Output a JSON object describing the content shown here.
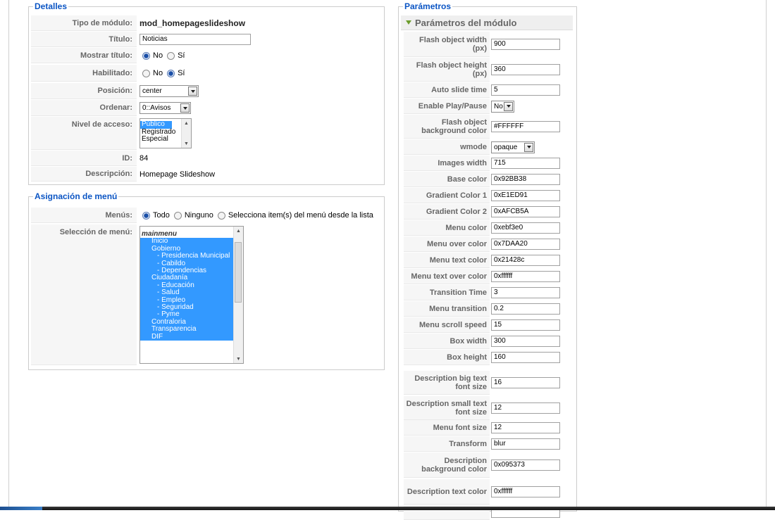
{
  "details": {
    "legend": "Detalles",
    "module_type_label": "Tipo de módulo:",
    "module_type_value": "mod_homepageslideshow",
    "title_label": "Título:",
    "title_value": "Noticias",
    "show_title_label": "Mostrar título:",
    "show_title_no": "No",
    "show_title_yes": "Sí",
    "show_title_selected": "No",
    "enabled_label": "Habilitado:",
    "enabled_no": "No",
    "enabled_yes": "Sí",
    "enabled_selected": "Sí",
    "position_label": "Posición:",
    "position_value": "center",
    "order_label": "Ordenar:",
    "order_value": "0::Avisos",
    "access_label": "Nivel de acceso:",
    "access_options": [
      "Público",
      "Registrado",
      "Especial"
    ],
    "access_selected": "Público",
    "id_label": "ID:",
    "id_value": "84",
    "description_label": "Descripción:",
    "description_value": "Homepage Slideshow"
  },
  "menu_assign": {
    "legend": "Asignación de menú",
    "menus_label": "Menús:",
    "opt_all": "Todo",
    "opt_none": "Ninguno",
    "opt_select": "Selecciona item(s) del menú desde la lista",
    "selected": "Todo",
    "selection_label": "Selección de menú:",
    "menu_group": "mainmenu",
    "items": [
      {
        "label": "Inicio",
        "level": 1
      },
      {
        "label": "Gobierno",
        "level": 1
      },
      {
        "label": "- Presidencia Municipal",
        "level": 2
      },
      {
        "label": "- Cabildo",
        "level": 2
      },
      {
        "label": "- Dependencias",
        "level": 2
      },
      {
        "label": "Ciudadanía",
        "level": 1
      },
      {
        "label": "- Educación",
        "level": 2
      },
      {
        "label": "- Salud",
        "level": 2
      },
      {
        "label": "- Empleo",
        "level": 2
      },
      {
        "label": "- Seguridad",
        "level": 2
      },
      {
        "label": "- Pyme",
        "level": 2
      },
      {
        "label": "Contraloria",
        "level": 1
      },
      {
        "label": "Transparencia",
        "level": 1
      },
      {
        "label": "DIF",
        "level": 1
      }
    ]
  },
  "params": {
    "legend": "Parámetros",
    "panel_title": "Parámetros del módulo",
    "rows": [
      {
        "label": "Flash object width (px)",
        "value": "900",
        "kind": "text"
      },
      {
        "label": "Flash object height (px)",
        "value": "360",
        "kind": "text"
      },
      {
        "label": "Auto slide time",
        "value": "5",
        "kind": "text"
      },
      {
        "label": "Enable Play/Pause",
        "value": "No",
        "kind": "select"
      },
      {
        "label": "Flash object background color",
        "value": "#FFFFFF",
        "kind": "text"
      },
      {
        "label": "wmode",
        "value": "opaque",
        "kind": "select"
      },
      {
        "label": "Images width",
        "value": "715",
        "kind": "text"
      },
      {
        "label": "Base color",
        "value": "0x92BB38",
        "kind": "text"
      },
      {
        "label": "Gradient Color 1",
        "value": "0xE1ED91",
        "kind": "text"
      },
      {
        "label": "Gradient Color 2",
        "value": "0xAFCB5A",
        "kind": "text"
      },
      {
        "label": "Menu color",
        "value": "0xebf3e0",
        "kind": "text"
      },
      {
        "label": "Menu over color",
        "value": "0x7DAA20",
        "kind": "text"
      },
      {
        "label": "Menu text color",
        "value": "0x21428c",
        "kind": "text"
      },
      {
        "label": "Menu text over color",
        "value": "0xffffff",
        "kind": "text"
      },
      {
        "label": "Transition Time",
        "value": "3",
        "kind": "text"
      },
      {
        "label": "Menu transition",
        "value": "0.2",
        "kind": "text"
      },
      {
        "label": "Menu scroll speed",
        "value": "15",
        "kind": "text"
      },
      {
        "label": "Box width",
        "value": "300",
        "kind": "text"
      },
      {
        "label": "Box height",
        "value": "160",
        "kind": "text"
      },
      {
        "label": "Description big text font size",
        "value": "16",
        "kind": "text"
      },
      {
        "label": "Description small text font size",
        "value": "12",
        "kind": "text"
      },
      {
        "label": "Menu font size",
        "value": "12",
        "kind": "text"
      },
      {
        "label": "Transform",
        "value": "blur",
        "kind": "text"
      },
      {
        "label": "Description background color",
        "value": "0x095373",
        "kind": "text"
      },
      {
        "label": "Description text color",
        "value": "0xffffff",
        "kind": "text"
      },
      {
        "label": "",
        "value": "",
        "kind": "text"
      }
    ]
  }
}
